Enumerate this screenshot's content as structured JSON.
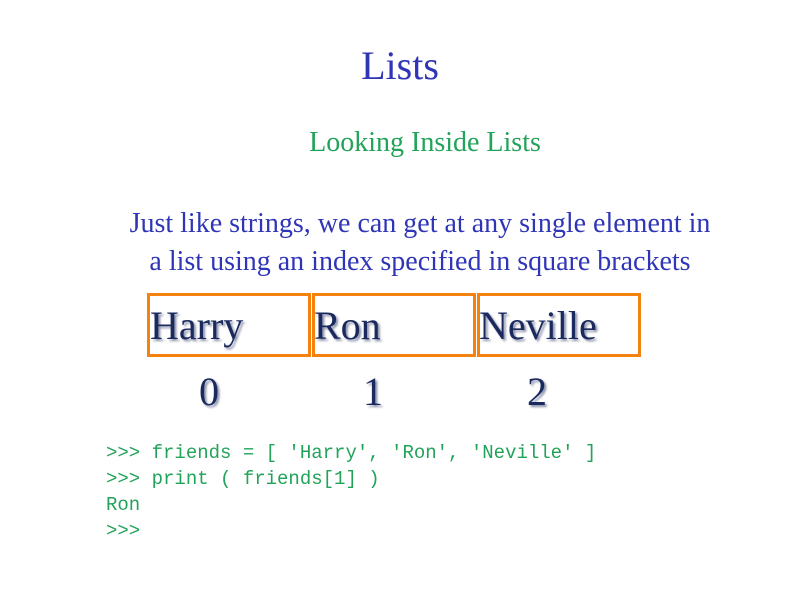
{
  "slide": {
    "title": "Lists",
    "subtitle": "Looking Inside Lists",
    "body_line_1": "Just like strings, we can get at any single element in",
    "body_line_2": "a list using an index specified in square brackets"
  },
  "list_diagram": {
    "items": [
      "Harry",
      "Ron",
      "Neville"
    ],
    "indices": [
      "0",
      "1",
      "2"
    ],
    "box_color": "#f5820f"
  },
  "code": {
    "lines": [
      ">>> friends = [ 'Harry', 'Ron', 'Neville' ]",
      ">>> print ( friends[1] )",
      "Ron",
      ">>>"
    ]
  },
  "colors": {
    "title": "#2f35b7",
    "subtitle": "#22a35a",
    "code": "#22a35a"
  }
}
